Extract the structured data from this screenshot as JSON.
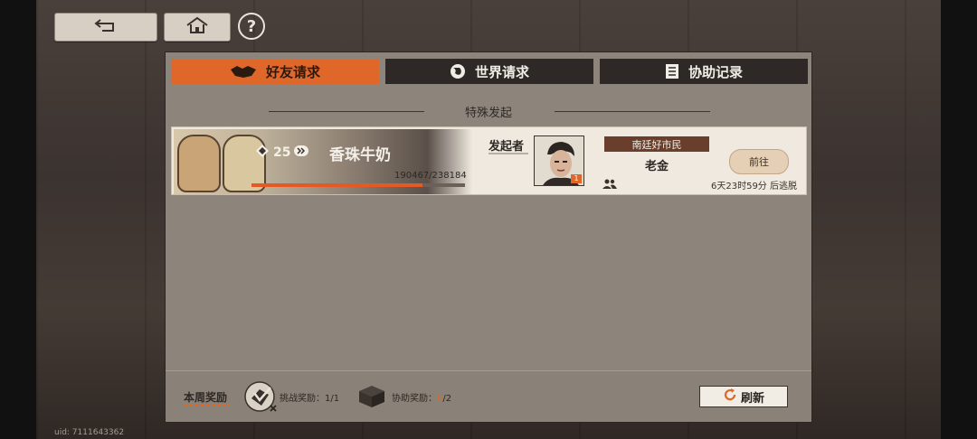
{
  "colors": {
    "accent": "#e0672a",
    "panel": "#8d857b",
    "tab_dark": "#2e2926",
    "card": "#efe9df"
  },
  "topbar": {
    "back_icon": "return-arrow-icon",
    "home_icon": "home-icon",
    "help_label": "?"
  },
  "tabs": [
    {
      "label": "好友请求",
      "icon": "handshake-icon",
      "active": true
    },
    {
      "label": "世界请求",
      "icon": "globe-icon",
      "active": false
    },
    {
      "label": "协助记录",
      "icon": "document-icon",
      "active": false
    }
  ],
  "section": {
    "title": "特殊发起"
  },
  "request": {
    "boss_level": "25",
    "boss_name": "香珠牛奶",
    "hp_current": 190467,
    "hp_max": 238184,
    "hp_text": "190467/238184",
    "initiator_label": "发起者",
    "avatar_badge": "1",
    "player_title": "南廷好市民",
    "player_name": "老金",
    "go_label": "前往",
    "timer_text": "6天23时59分  后逃脱"
  },
  "footer": {
    "week_label": "本周奖励",
    "challenge_reward": "挑战奖励：1/1",
    "assist_reward_prefix": "协助奖励：",
    "assist_reward_current": "0",
    "assist_reward_suffix": "/2",
    "refresh_label": "刷新"
  },
  "uid_text": "uid: 7111643362"
}
